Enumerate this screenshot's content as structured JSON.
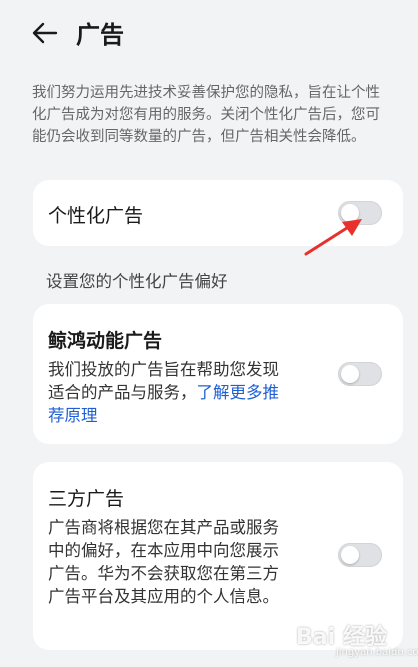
{
  "header": {
    "title": "广告",
    "back_icon": "arrow-left-icon"
  },
  "intro_text": "我们努力运用先进技术妥善保护您的隐私，旨在让个性化广告成为对您有用的服务。关闭个性化广告后，您可能仍会收到同等数量的广告，但广告相关性会降低。",
  "personalized": {
    "label": "个性化广告",
    "enabled": false
  },
  "section_label": "设置您的个性化广告偏好",
  "whale": {
    "title": "鲸鸿动能广告",
    "desc": "我们投放的广告旨在帮助您发现适合的产品与服务，",
    "link": "了解更多推荐原理",
    "enabled": false
  },
  "third_party": {
    "title": "三方广告",
    "desc": "广告商将根据您在其产品或服务中的偏好，在本应用中向您展示广告。华为不会获取您在第三方广告平台及其应用的个人信息。",
    "enabled": false
  },
  "watermark": {
    "text": "Bai 经验",
    "sub": "jingyan.baidu.com"
  },
  "colors": {
    "background": "#f1f3f5",
    "card": "#ffffff",
    "link": "#1f5fd6",
    "arrow": "#e8312c",
    "toggle_off": "#dfe1e4"
  }
}
